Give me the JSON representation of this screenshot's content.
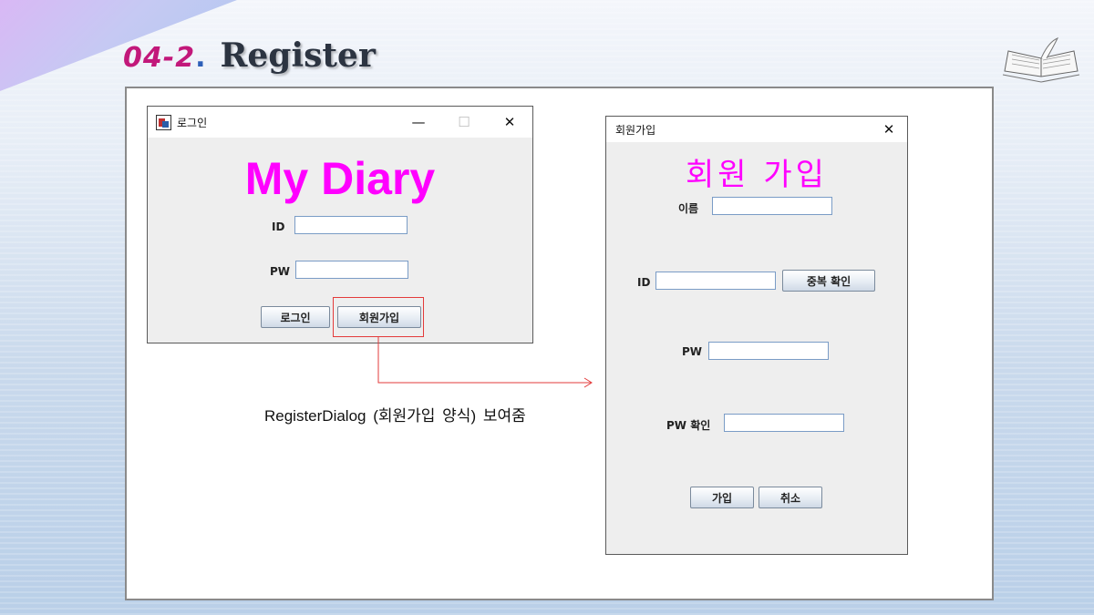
{
  "slide": {
    "number": "04-2",
    "dot": ".",
    "title": "Register",
    "caption": "RegisterDialog (회원가입 양식) 보여줌"
  },
  "login_window": {
    "title": "로그인",
    "controls": {
      "minimize": "—",
      "maximize": "☐",
      "close": "✕"
    },
    "app_title": "My Diary",
    "id_label": "ID",
    "id_value": "",
    "pw_label": "PW",
    "pw_value": "",
    "login_button": "로그인",
    "register_button": "회원가입"
  },
  "register_window": {
    "title": "회원가입",
    "close": "✕",
    "heading": "회원 가입",
    "name_label": "이름",
    "name_value": "",
    "id_label": "ID",
    "id_value": "",
    "check_button": "중복 확인",
    "pw_label": "PW",
    "pw_value": "",
    "pw_confirm_label": "PW 확인",
    "pw_confirm_value": "",
    "join_button": "가입",
    "cancel_button": "취소"
  },
  "colors": {
    "accent_magenta": "#ff00ff",
    "title_pink": "#c2187a",
    "highlight_red": "#e33b3b"
  }
}
